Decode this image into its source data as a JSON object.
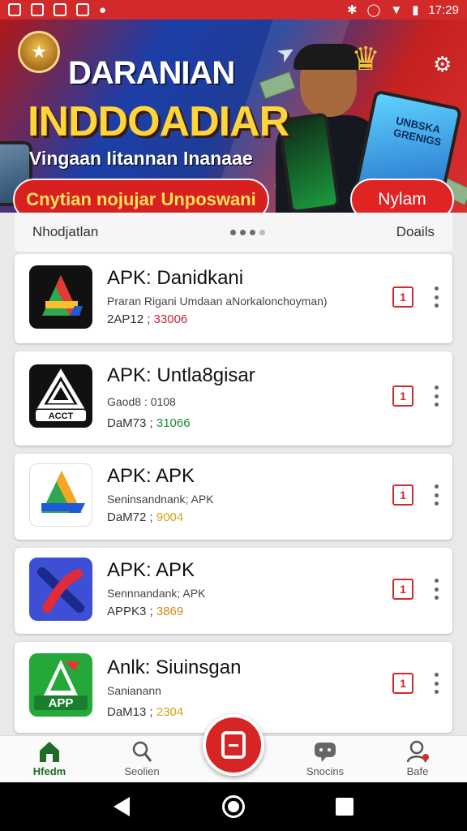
{
  "status_bar": {
    "time": "17:29",
    "left_icons": [
      "photo-icon",
      "close-box-icon",
      "mail-icon",
      "app-icon",
      "game-icon"
    ],
    "right_icons": [
      "bluetooth-icon",
      "vibrate-icon",
      "wifi-icon",
      "battery-icon"
    ]
  },
  "banner": {
    "title": "DARANIAN",
    "subtitle": "INDDOADIAR",
    "tagline": "Vingaan Iitannan Inanaae",
    "pill_text": "Cnytian nojujar Unposwani",
    "cta_label": "Nylam",
    "phone_text": "UNBSKA GRENIGS"
  },
  "section": {
    "left_label": "Nhodjatlan",
    "right_label": "Doails"
  },
  "apps": [
    {
      "name": "APK: Danidkani",
      "desc": "Praran Rigani Umdaan aNorkalonchoyman)",
      "stat_label": "2AP12 ; ",
      "stat_value": "33006",
      "stat_color": "#c0283a"
    },
    {
      "name": "APK: Untla8gisar",
      "desc": "Gaod8 : 0108",
      "stat_label": "DaM73 ; ",
      "stat_value": "31066",
      "stat_color": "#1f8a35"
    },
    {
      "name": "APK: APK",
      "desc": "Seninsandnank; APK",
      "stat_label": "DaM72 ; ",
      "stat_value": "9004",
      "stat_color": "#d4a21a"
    },
    {
      "name": "APK: APK",
      "desc": "Sennnandank; APK",
      "stat_label": "APPK3 ; ",
      "stat_value": "3869",
      "stat_color": "#d68a1a"
    },
    {
      "name": "Anlk: Siuinsgan",
      "desc": "Sanianann",
      "stat_label": "DaM13 ; ",
      "stat_value": "2304",
      "stat_color": "#d4a21a"
    }
  ],
  "app_icon_texts": {
    "icon2": "ACCT",
    "icon5": "APP"
  },
  "install_glyph": "1",
  "bottom_nav": {
    "items": [
      {
        "label": "Hfedm",
        "icon": "home-icon",
        "active": true
      },
      {
        "label": "Seolien",
        "icon": "search-icon",
        "active": false
      },
      {
        "label": "Snocins",
        "icon": "chat-icon",
        "active": false
      },
      {
        "label": "Bafe",
        "icon": "profile-icon",
        "active": false
      }
    ]
  },
  "colors": {
    "accent": "#d22a2a",
    "nav_active": "#1f6b2a",
    "status_bar": "#d22a2a"
  }
}
